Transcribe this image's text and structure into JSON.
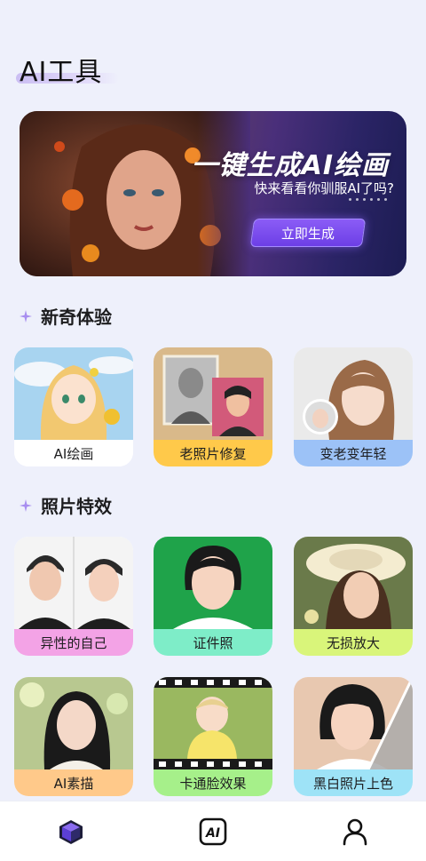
{
  "header": {
    "title": "AI工具"
  },
  "banner": {
    "headline": "一键生成AI绘画",
    "subtitle": "快来看看你驯服AI了吗?",
    "cta_label": "立即生成"
  },
  "sections": [
    {
      "title": "新奇体验",
      "cards": [
        {
          "label": "AI绘画",
          "label_bg": "#ffffff"
        },
        {
          "label": "老照片修复",
          "label_bg": "#ffc94a"
        },
        {
          "label": "变老变年轻",
          "label_bg": "#9cc2f7"
        }
      ]
    },
    {
      "title": "照片特效",
      "cards": [
        {
          "label": "异性的自己",
          "label_bg": "#f3a3e6"
        },
        {
          "label": "证件照",
          "label_bg": "#7eedc8"
        },
        {
          "label": "无损放大",
          "label_bg": "#d9f57a"
        },
        {
          "label": "AI素描",
          "label_bg": "#ffc98a"
        },
        {
          "label": "卡通脸效果",
          "label_bg": "#a6f08a"
        },
        {
          "label": "黑白照片上色",
          "label_bg": "#9ee3f7"
        }
      ]
    }
  ],
  "tabbar": {
    "items": [
      {
        "icon": "cube-icon",
        "active": true
      },
      {
        "icon": "ai-icon",
        "active": false
      },
      {
        "icon": "person-icon",
        "active": false
      }
    ]
  },
  "colors": {
    "accent": "#7c4dff",
    "background": "#eef0fb"
  }
}
